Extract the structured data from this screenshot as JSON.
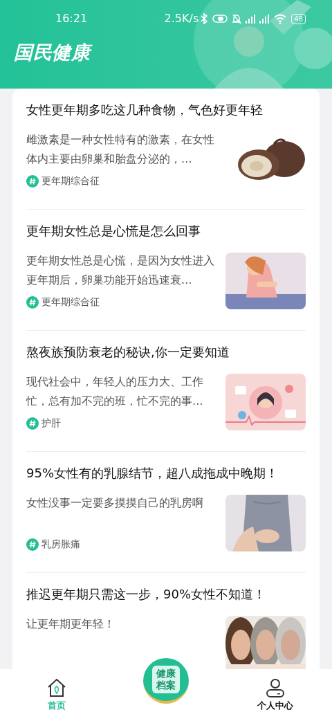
{
  "status_bar": {
    "time": "16:21",
    "speed": "2.5K/s",
    "battery": "48"
  },
  "header": {
    "title": "国民健康"
  },
  "articles": [
    {
      "title": "女性更年期多吃这几种食物，气色好更年轻",
      "summary": "雌激素是一种女性特有的激素，在女性体内主要由卵巢和胎盘分泌的，…",
      "tag": "更年期综合征"
    },
    {
      "title": "更年期女性总是心慌是怎么回事",
      "summary": "更年期女性总是心慌，是因为女性进入更年期后，卵巢功能开始迅速衰…",
      "tag": "更年期综合征"
    },
    {
      "title": "熬夜族预防衰老的秘诀,你一定要知道",
      "summary": "现代社会中，年轻人的压力大、工作忙，总有加不完的班，忙不完的事…",
      "tag": "护肝"
    },
    {
      "title": "95%女性有的乳腺结节，超八成拖成中晚期！",
      "summary": "女性没事一定要多摸摸自己的乳房啊",
      "tag": "乳房胀痛"
    },
    {
      "title": "推迟更年期只需这一步，90%女性不知道！",
      "summary": "让更年期更年轻！"
    }
  ],
  "bottom_nav": [
    {
      "kind": "home",
      "label": "首页",
      "selected": true
    },
    {
      "kind": "center",
      "label": "健康档案",
      "selected": false
    },
    {
      "kind": "profile",
      "label": "个人中心",
      "selected": false
    }
  ]
}
